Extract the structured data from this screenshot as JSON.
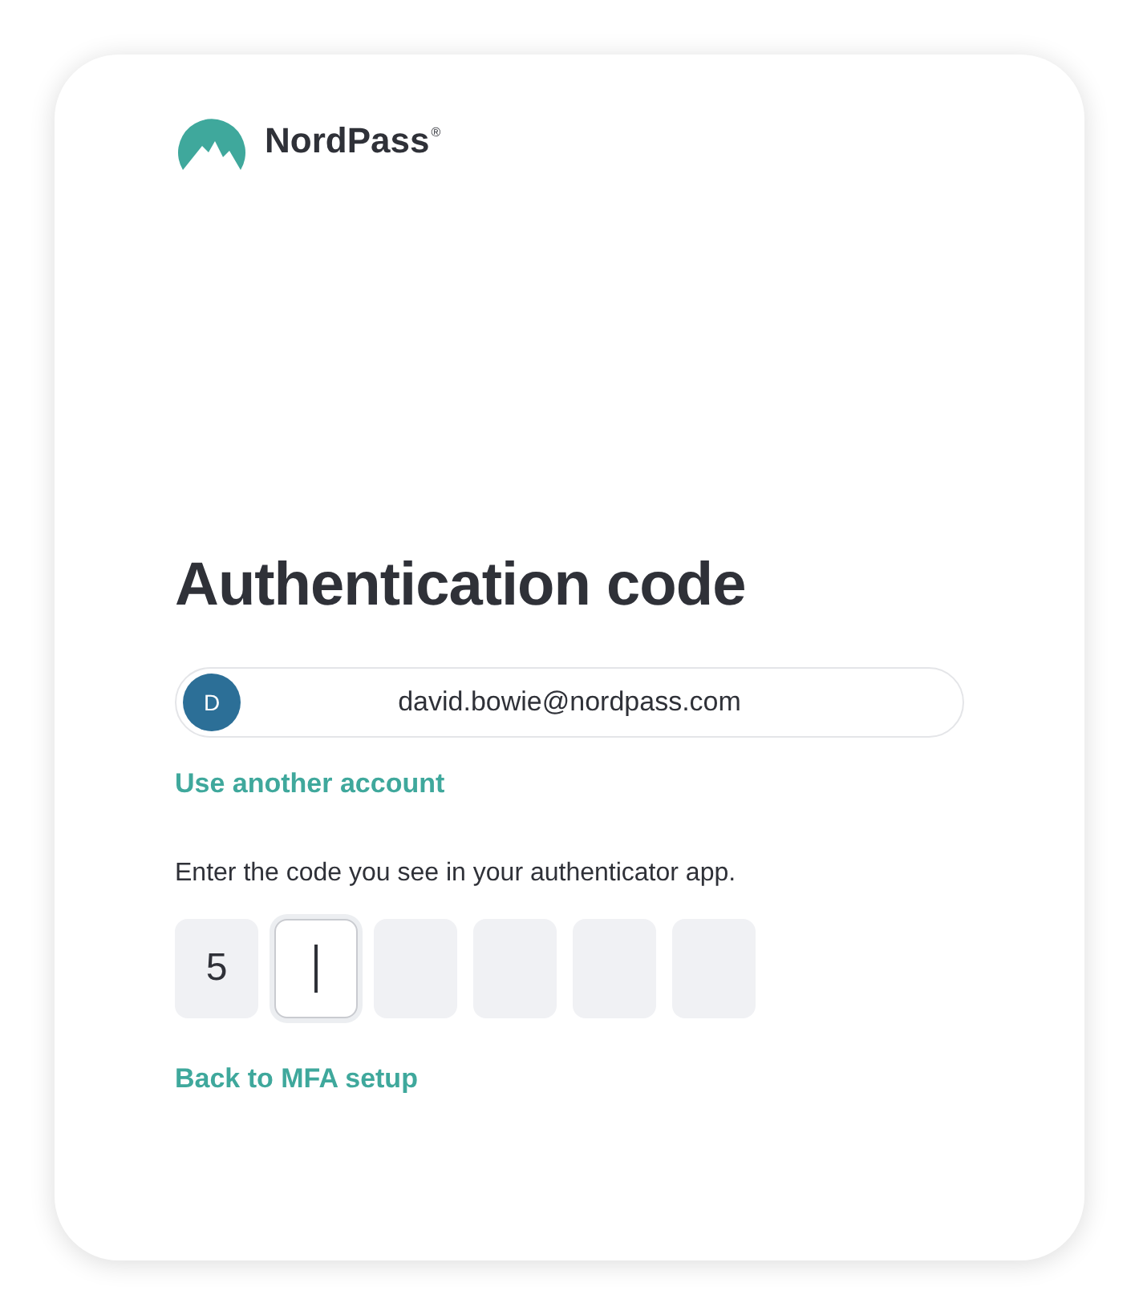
{
  "logo": {
    "name": "NordPass",
    "mark": "®"
  },
  "title": "Authentication code",
  "account": {
    "initial": "D",
    "email": "david.bowie@nordpass.com"
  },
  "switch_link": "Use another account",
  "instruction": "Enter the code you see in your authenticator app.",
  "code_digits": [
    {
      "value": "5",
      "focused": false
    },
    {
      "focused": true
    },
    {
      "focused": false
    },
    {
      "focused": false
    },
    {
      "focused": false
    },
    {
      "focused": false
    }
  ],
  "back_link": "Back to MFA setup"
}
